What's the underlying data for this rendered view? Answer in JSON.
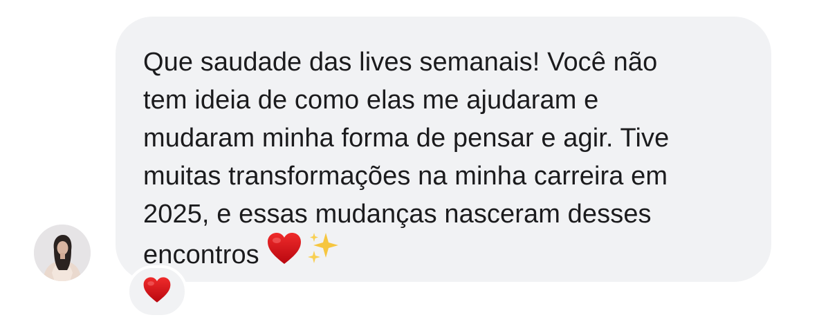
{
  "message": {
    "text": "Que saudade das lives semanais! Você não\ntem ideia de como elas me ajudaram e\nmudaram minha forma de pensar e agir. Tive\nmuitas transformações na minha carreira em\n2025, e essas mudanças nasceram desses\nencontros",
    "trailing_emojis": [
      "red-heart-icon",
      "sparkles-icon"
    ]
  },
  "reaction": {
    "icon": "red-heart-icon"
  },
  "colors": {
    "bubble_background": "#f1f2f4",
    "text": "#1b1b1d",
    "heart": "#d7111b",
    "sparkles": "#f6c640"
  }
}
